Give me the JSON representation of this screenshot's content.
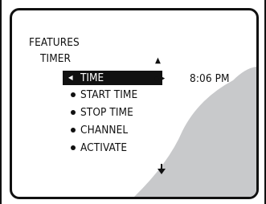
{
  "menu": {
    "title": "FEATURES",
    "submenu_title": "TIMER",
    "items": [
      {
        "label": "TIME",
        "selected": true
      },
      {
        "label": "START TIME",
        "selected": false
      },
      {
        "label": "STOP TIME",
        "selected": false
      },
      {
        "label": "CHANNEL",
        "selected": false
      },
      {
        "label": "ACTIVATE",
        "selected": false
      }
    ]
  },
  "value": {
    "time": "8:06 PM"
  },
  "icons": {
    "selected_arrow": "left-triangle-icon",
    "adjust": "dot-right-arrow-icon",
    "scroll_up": "up-triangle-icon",
    "scroll_down": "down-arrow-icon"
  },
  "colors": {
    "text": "#111111",
    "highlight_bg": "#111111",
    "highlight_text": "#ffffff",
    "sweep": "#c8c9cb"
  }
}
